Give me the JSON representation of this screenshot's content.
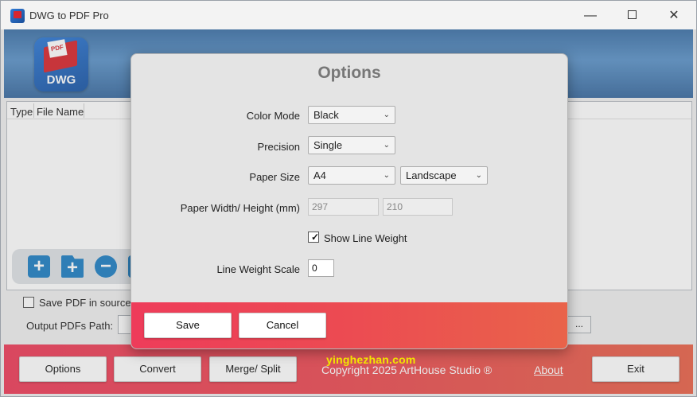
{
  "window": {
    "title": "DWG to PDF Pro",
    "controls": {
      "minimize": "—",
      "close": "✕"
    }
  },
  "header": {
    "logo_text": "DWG",
    "logo_page_text": "PDF"
  },
  "file_list": {
    "columns": [
      "Type",
      "File Name"
    ]
  },
  "toolbar": {
    "icons": [
      "add-file-icon",
      "add-folder-icon",
      "remove-icon",
      "more-icon"
    ],
    "add_glyph": "+",
    "folder_glyph": "+",
    "remove_glyph": "−"
  },
  "save_in_source": {
    "label": "Save PDF in source",
    "checked": false
  },
  "output": {
    "label": "Output PDFs Path:",
    "value": "",
    "browse_label": "..."
  },
  "bottom": {
    "options": "Options",
    "convert": "Convert",
    "merge_split": "Merge/ Split",
    "copyright": "Copyright 2025 ArtHouse Studio ®",
    "about": "About",
    "exit": "Exit"
  },
  "dialog": {
    "title": "Options",
    "color_mode": {
      "label": "Color Mode",
      "value": "Black"
    },
    "precision": {
      "label": "Precision",
      "value": "Single"
    },
    "paper_size": {
      "label": "Paper Size",
      "size": "A4",
      "orientation": "Landscape"
    },
    "paper_wh": {
      "label": "Paper Width/ Height (mm)",
      "width": "297",
      "height": "210"
    },
    "show_line_weight": {
      "label": "Show Line Weight",
      "checked": true,
      "mark": "✓"
    },
    "line_weight_scale": {
      "label": "Line Weight Scale",
      "value": "0"
    },
    "save": "Save",
    "cancel": "Cancel"
  },
  "watermark": "yinghezhan.com",
  "colors": {
    "accent_red": "#ee3c5a",
    "accent_orange": "#e9634a",
    "header_blue": "#5d94c9"
  }
}
